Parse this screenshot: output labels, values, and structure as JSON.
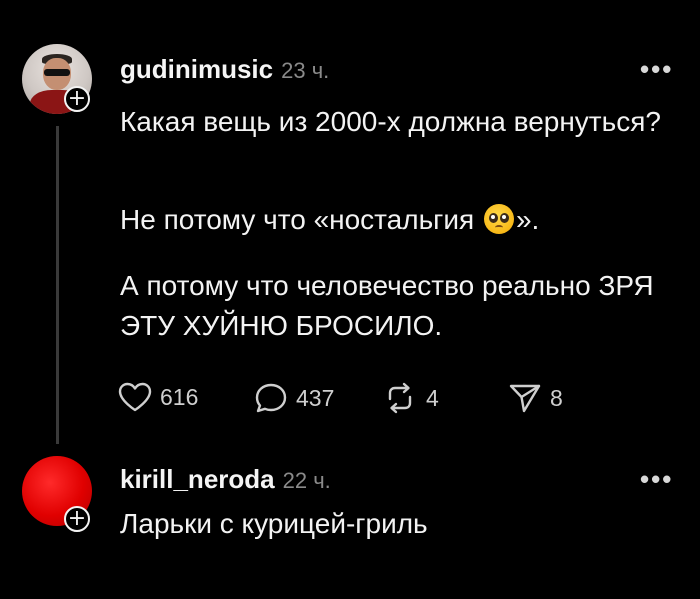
{
  "post": {
    "username": "gudinimusic",
    "time": "23 ч.",
    "more": "•••",
    "paragraphs": [
      "Какая вещь из 2000-х должна вернуться?",
      "Не потому что «ностальгия",
      "».",
      "А потому что человечество реально ЗРЯ ЭТУ ХУЙНЮ БРОСИЛО."
    ],
    "emoji": "pleading-face-emoji",
    "actions": {
      "likes": "616",
      "comments": "437",
      "reposts": "4",
      "shares": "8"
    }
  },
  "reply": {
    "username": "kirill_neroda",
    "time": "22 ч.",
    "more": "•••",
    "text": "Ларьки с курицей-гриль"
  },
  "icons": {
    "follow_button": "+",
    "like": "heart-icon",
    "comment": "comment-bubble-icon",
    "repost": "repost-icon",
    "share": "send-icon"
  },
  "colors": {
    "background": "#000000",
    "text": "#f3f3f3",
    "muted": "#8a8a8a",
    "avatar2": "#e00000"
  }
}
